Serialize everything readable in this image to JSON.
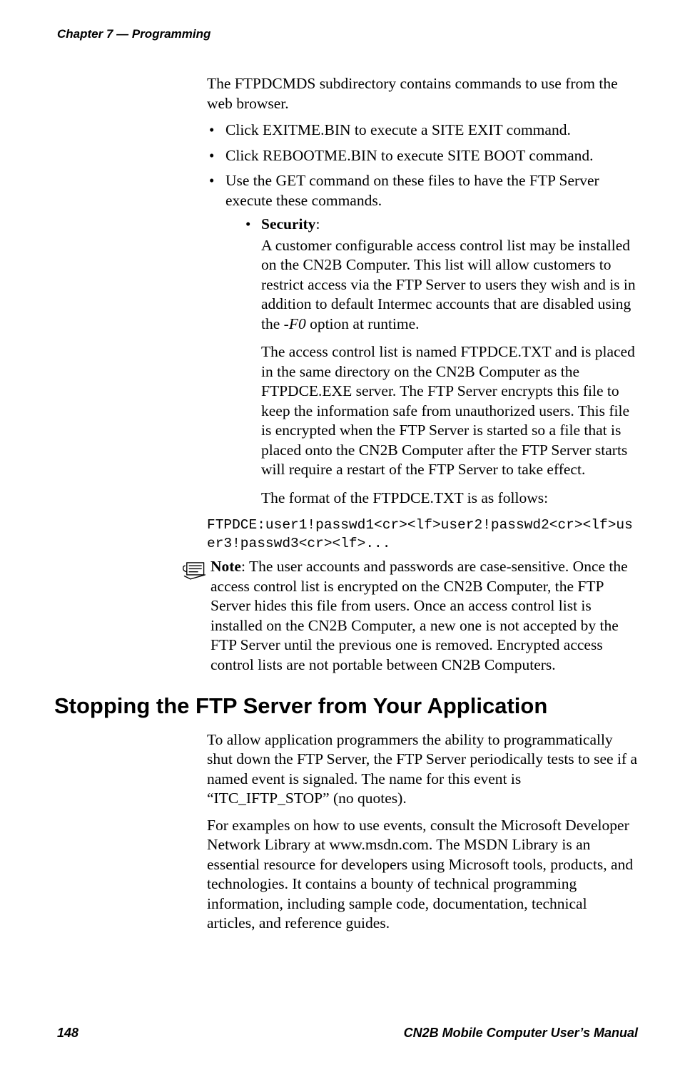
{
  "running_head": "Chapter 7 — Programming",
  "intro": "The FTPDCMDS subdirectory contains commands to use from the web browser.",
  "bullets": {
    "b1": "Click EXITME.BIN to execute a SITE EXIT command.",
    "b2": "Click REBOOTME.BIN to execute SITE BOOT command.",
    "b3": "Use the GET command on these files to have the FTP Server execute these commands."
  },
  "security": {
    "label": "Security",
    "colon": ":",
    "p1a": "A customer configurable access control list may be installed on the CN2B Computer. This list will allow customers to restrict access via the FTP Server to users they wish and is in addition to default Intermec accounts that are disabled using the ",
    "p1flag": "-F0",
    "p1b": " option at runtime.",
    "p2": "The access control list is named FTPDCE.TXT and is placed in the same directory on the CN2B Computer as the FTPDCE.EXE server. The FTP Server encrypts this file to keep the information safe from unauthorized users. This file is encrypted when the FTP Server is started so a file that is placed onto the CN2B Computer after the FTP Server starts will require a restart of the FTP Server to take effect.",
    "p3": "The format of the FTPDCE.TXT is as follows:"
  },
  "code_line": "FTPDCE:user1!passwd1<cr><lf>user2!passwd2<cr><lf>user3!passwd3<cr><lf>...",
  "note": {
    "label": "Note",
    "body": ": The user accounts and passwords are case-sensitive. Once the access control list is encrypted on the CN2B Computer, the FTP Server hides this file from users. Once an access control list is installed on the CN2B Computer, a new one is not accepted by the FTP Server until the previous one is removed. Encrypted access control lists are not portable between CN2B Computers."
  },
  "heading2": "Stopping the FTP Server from Your Application",
  "stop": {
    "p1": "To allow application programmers the ability to programmatically shut down the FTP Server, the FTP Server periodically tests to see if a named event is signaled. The name for this event is “ITC_IFTP_STOP” (no quotes).",
    "p2": "For examples on how to use events, consult the Microsoft Developer Network Library at www.msdn.com. The MSDN Library is an essential resource for developers using Microsoft tools, products, and technologies. It contains a bounty of technical programming information, including sample code, documentation, technical articles, and reference guides."
  },
  "footer": {
    "page_number": "148",
    "manual_title": "CN2B Mobile Computer User’s Manual"
  }
}
